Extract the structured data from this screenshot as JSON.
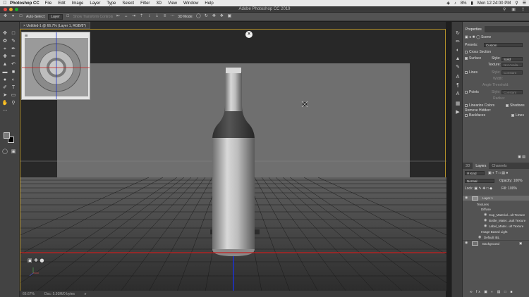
{
  "menubar": {
    "app_name": "Photoshop CC",
    "items": [
      "File",
      "Edit",
      "Image",
      "Layer",
      "Type",
      "Select",
      "Filter",
      "3D",
      "View",
      "Window",
      "Help"
    ],
    "battery": "8%",
    "clock": "Mon 12:24:00 PM"
  },
  "titlebar": {
    "title": "Adobe Photoshop CC 2019"
  },
  "options": {
    "auto_select_label": "Auto-Select:",
    "auto_select_value": "Layer",
    "transform_label": "Show Transform Controls",
    "mode_label": "3D Mode:"
  },
  "document": {
    "tab_title": "Untitled-1 @ 66.7% (Layer 1, RGB/8*)",
    "zoom": "66.67%",
    "doc_info": "Doc: 5.93M/0 bytes"
  },
  "properties": {
    "tabs": [
      "Properties"
    ],
    "scene_label": "Scene",
    "presets_label": "Presets:",
    "presets_value": "Custom",
    "cross_section": "Cross Section",
    "surface": "Surface",
    "style_label": "Style:",
    "surface_style": "Solid",
    "texture_label": "Texture:",
    "texture_value": "Not Availa...",
    "lines": "Lines",
    "lines_style": "Constant",
    "width_label": "Width:",
    "angle_label": "Angle Threshold:",
    "points": "Points",
    "points_style": "Constant",
    "radius_label": "Radius:",
    "linearize_colors": "Linearize Colors",
    "shadows": "Shadows",
    "remove_hidden": "Remove Hidden:",
    "backfaces": "Backfaces",
    "lines_check": "Lines"
  },
  "layers": {
    "tabs": [
      "3D",
      "Layers",
      "Channels"
    ],
    "kind_label": "Kind",
    "blend_mode": "Normal",
    "opacity_label": "Opacity:",
    "opacity_value": "100%",
    "lock_label": "Lock:",
    "fill_label": "Fill:",
    "fill_value": "100%",
    "rows": [
      {
        "label": "Layer 1"
      },
      {
        "label": "Textures"
      },
      {
        "label": "Diffuse"
      },
      {
        "label": "Cap_Material...ult Texture"
      },
      {
        "label": "Bottle_Mater...ault Texture"
      },
      {
        "label": "Label_Mater...ult Texture"
      },
      {
        "label": "Image Based Light"
      },
      {
        "label": "Default IBL"
      },
      {
        "label": "Background"
      }
    ]
  },
  "colors": {
    "accent_gold": "#b08f2a",
    "axis_red": "#c81e1e",
    "axis_blue": "#1e32c8"
  }
}
